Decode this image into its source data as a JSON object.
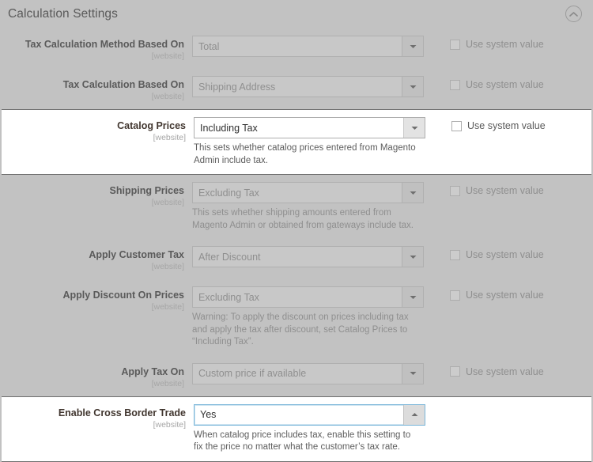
{
  "section": {
    "title": "Calculation Settings",
    "collapse_icon": "chevron-up-circle-icon"
  },
  "common": {
    "scope_label": "[website]",
    "use_system_value_label": "Use system value",
    "dropdown_icon": "chevron-down-icon",
    "dropdown_open_icon": "chevron-up-icon"
  },
  "colors": {
    "page_background": "#c2c2c2",
    "highlight_background": "#ffffff",
    "highlight_border": "#6e6e6e",
    "focus_border": "#79b6d9",
    "label_text": "#5a5a5a",
    "muted_text": "#8f8f8f"
  },
  "fields": [
    {
      "name": "tax-calculation-method-based-on",
      "label": "Tax Calculation Method Based On",
      "scope": "[website]",
      "value": "Total",
      "hint": "",
      "highlighted": false,
      "expanded": false,
      "use_system_value": false,
      "use_system_value_label": "Use system value"
    },
    {
      "name": "tax-calculation-based-on",
      "label": "Tax Calculation Based On",
      "scope": "[website]",
      "value": "Shipping Address",
      "hint": "",
      "highlighted": false,
      "expanded": false,
      "use_system_value": false,
      "use_system_value_label": "Use system value"
    },
    {
      "name": "catalog-prices",
      "label": "Catalog Prices",
      "scope": "[website]",
      "value": "Including Tax",
      "hint": "This sets whether catalog prices entered from Magento Admin include tax.",
      "highlighted": true,
      "expanded": false,
      "use_system_value": false,
      "use_system_value_label": "Use system value"
    },
    {
      "name": "shipping-prices",
      "label": "Shipping Prices",
      "scope": "[website]",
      "value": "Excluding Tax",
      "hint": "This sets whether shipping amounts entered from Magento Admin or obtained from gateways include tax.",
      "highlighted": false,
      "expanded": false,
      "use_system_value": false,
      "use_system_value_label": "Use system value"
    },
    {
      "name": "apply-customer-tax",
      "label": "Apply Customer Tax",
      "scope": "[website]",
      "value": "After Discount",
      "hint": "",
      "highlighted": false,
      "expanded": false,
      "use_system_value": false,
      "use_system_value_label": "Use system value"
    },
    {
      "name": "apply-discount-on-prices",
      "label": "Apply Discount On Prices",
      "scope": "[website]",
      "value": "Excluding Tax",
      "hint": "Warning: To apply the discount on prices including tax and apply the tax after discount, set Catalog Prices to “Including Tax”.",
      "highlighted": false,
      "expanded": false,
      "use_system_value": false,
      "use_system_value_label": "Use system value"
    },
    {
      "name": "apply-tax-on",
      "label": "Apply Tax On",
      "scope": "[website]",
      "value": "Custom price if available",
      "hint": "",
      "highlighted": false,
      "expanded": false,
      "use_system_value": false,
      "use_system_value_label": "Use system value"
    },
    {
      "name": "enable-cross-border-trade",
      "label": "Enable Cross Border Trade",
      "scope": "[website]",
      "value": "Yes",
      "hint": "When catalog price includes tax, enable this setting to fix the price no matter what the customer’s tax rate.",
      "highlighted": true,
      "expanded": true,
      "use_system_value": null,
      "use_system_value_label": ""
    }
  ]
}
